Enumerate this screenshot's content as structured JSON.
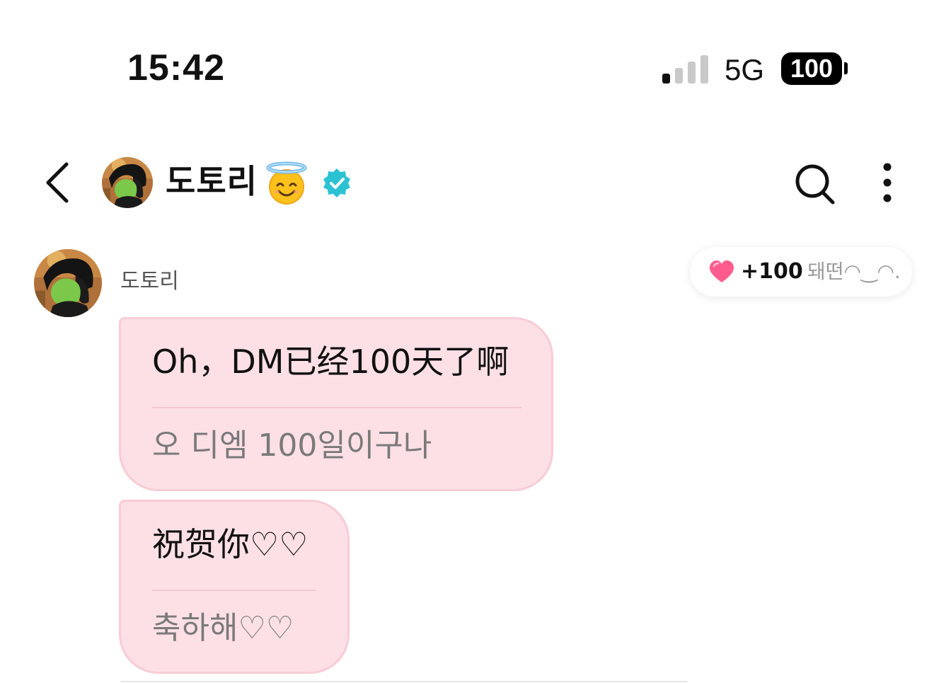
{
  "status_bar": {
    "time": "15:42",
    "network": "5G",
    "battery": "100",
    "signal_bars_active": 1,
    "signal_bars_total": 4
  },
  "header": {
    "contact_name": "도토리",
    "emoji": "smiling-face-with-halo",
    "verified": true,
    "accent_color": "#2bc3d3"
  },
  "messages": {
    "sender_name": "도토리",
    "reaction": {
      "icon": "heart-icon",
      "count": "+100",
      "nickname": "돼떤◠‿◠."
    },
    "bubbles": [
      {
        "original": "Oh，DM已经100天了啊",
        "translation": "오 디엠 100일이구나"
      },
      {
        "original": "祝贺你♡♡",
        "translation": "축하해♡♡"
      }
    ],
    "bubble_color": "#fde0e6"
  }
}
